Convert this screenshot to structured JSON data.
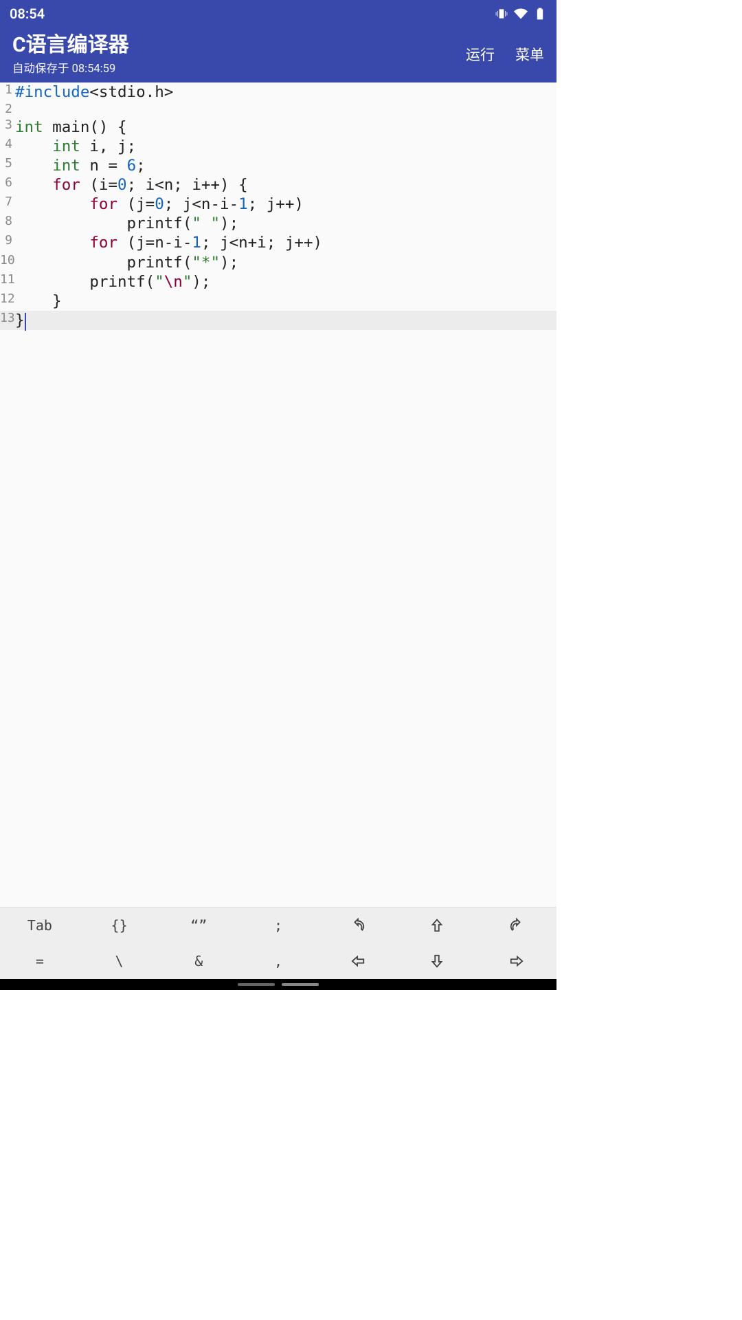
{
  "status": {
    "time": "08:54"
  },
  "appbar": {
    "title": "C语言编译器",
    "subtitle": "自动保存于 08:54:59",
    "run": "运行",
    "menu": "菜单"
  },
  "code": {
    "cursor_line": 13,
    "lines": [
      {
        "n": 1,
        "tokens": [
          [
            "pp",
            "#include"
          ],
          [
            "def",
            "<stdio.h>"
          ]
        ]
      },
      {
        "n": 2,
        "tokens": []
      },
      {
        "n": 3,
        "tokens": [
          [
            "kw",
            "int"
          ],
          [
            "def",
            " main() {"
          ]
        ]
      },
      {
        "n": 4,
        "tokens": [
          [
            "def",
            "    "
          ],
          [
            "kw",
            "int"
          ],
          [
            "def",
            " i, j;"
          ]
        ]
      },
      {
        "n": 5,
        "tokens": [
          [
            "def",
            "    "
          ],
          [
            "kw",
            "int"
          ],
          [
            "def",
            " n = "
          ],
          [
            "num",
            "6"
          ],
          [
            "def",
            ";"
          ]
        ]
      },
      {
        "n": 6,
        "tokens": [
          [
            "def",
            "    "
          ],
          [
            "kw2",
            "for"
          ],
          [
            "def",
            " (i="
          ],
          [
            "num",
            "0"
          ],
          [
            "def",
            "; i<n; i++) {"
          ]
        ]
      },
      {
        "n": 7,
        "tokens": [
          [
            "def",
            "        "
          ],
          [
            "kw2",
            "for"
          ],
          [
            "def",
            " (j="
          ],
          [
            "num",
            "0"
          ],
          [
            "def",
            "; j<n-i-"
          ],
          [
            "num",
            "1"
          ],
          [
            "def",
            "; j++)"
          ]
        ]
      },
      {
        "n": 8,
        "tokens": [
          [
            "def",
            "            printf("
          ],
          [
            "str",
            "\" \""
          ],
          [
            "def",
            ");"
          ]
        ]
      },
      {
        "n": 9,
        "tokens": [
          [
            "def",
            "        "
          ],
          [
            "kw2",
            "for"
          ],
          [
            "def",
            " (j=n-i-"
          ],
          [
            "num",
            "1"
          ],
          [
            "def",
            "; j<n+i; j++)"
          ]
        ]
      },
      {
        "n": 10,
        "tokens": [
          [
            "def",
            "            printf("
          ],
          [
            "str",
            "\"*\""
          ],
          [
            "def",
            ");"
          ]
        ]
      },
      {
        "n": 11,
        "tokens": [
          [
            "def",
            "        printf("
          ],
          [
            "str",
            "\""
          ],
          [
            "esc",
            "\\n"
          ],
          [
            "str",
            "\""
          ],
          [
            "def",
            ");"
          ]
        ]
      },
      {
        "n": 12,
        "tokens": [
          [
            "def",
            "    }"
          ]
        ]
      },
      {
        "n": 13,
        "tokens": [
          [
            "def",
            "}"
          ]
        ]
      }
    ]
  },
  "kbar": {
    "row1": [
      "Tab",
      "{}",
      "“”",
      ";",
      "undo-icon",
      "up-arrow-icon",
      "redo-icon"
    ],
    "row2": [
      "=",
      "\\",
      "&",
      ",",
      "left-arrow-icon",
      "down-arrow-icon",
      "right-arrow-icon"
    ]
  }
}
